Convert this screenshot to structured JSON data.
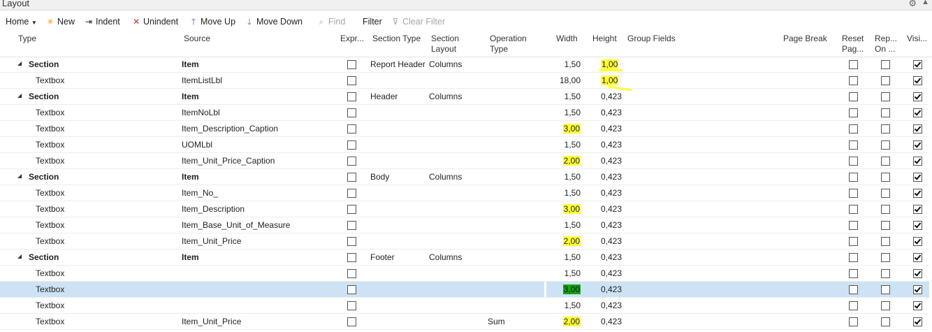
{
  "window": {
    "title": "Layout"
  },
  "toolbar": {
    "home": "Home",
    "new": "New",
    "indent": "Indent",
    "unindent": "Unindent",
    "move_up": "Move Up",
    "move_down": "Move Down",
    "find": "Find",
    "filter": "Filter",
    "clear_filter": "Clear Filter"
  },
  "columns": {
    "type": "Type",
    "source": "Source",
    "expr": "Expr...",
    "section_type": "Section Type",
    "section_layout_1": "Section",
    "section_layout_2": "Layout",
    "operation_type_1": "Operation",
    "operation_type_2": "Type",
    "width": "Width",
    "height": "Height",
    "group_fields": "Group Fields",
    "page_break": "Page Break",
    "reset_page_1": "Reset",
    "reset_page_2": "Pag...",
    "repeat_1": "Rep...",
    "repeat_2": "On ...",
    "visible": "Visi..."
  },
  "rows": [
    {
      "section": true,
      "type": "Section",
      "source": "Item",
      "expr": false,
      "section_type": "Report Header",
      "section_layout": "Columns",
      "operation_type": "",
      "width": "1,50",
      "height": "1,00",
      "width_hl": false,
      "height_hl": true,
      "reset": false,
      "repeat": false,
      "visible": true
    },
    {
      "section": false,
      "type": "Textbox",
      "source": "ItemListLbl",
      "expr": false,
      "section_type": "",
      "section_layout": "",
      "operation_type": "",
      "width": "18,00",
      "height": "1,00",
      "width_hl": false,
      "height_hl": true,
      "reset": false,
      "repeat": false,
      "visible": true
    },
    {
      "section": true,
      "type": "Section",
      "source": "Item",
      "expr": false,
      "section_type": "Header",
      "section_layout": "Columns",
      "operation_type": "",
      "width": "1,50",
      "height": "0,423",
      "width_hl": false,
      "height_hl": false,
      "reset": false,
      "repeat": false,
      "visible": true
    },
    {
      "section": false,
      "type": "Textbox",
      "source": "ItemNoLbl",
      "expr": false,
      "section_type": "",
      "section_layout": "",
      "operation_type": "",
      "width": "1,50",
      "height": "0,423",
      "width_hl": false,
      "height_hl": false,
      "reset": false,
      "repeat": false,
      "visible": true
    },
    {
      "section": false,
      "type": "Textbox",
      "source": "Item_Description_Caption",
      "expr": false,
      "section_type": "",
      "section_layout": "",
      "operation_type": "",
      "width": "3,00",
      "height": "0,423",
      "width_hl": true,
      "height_hl": false,
      "reset": false,
      "repeat": false,
      "visible": true
    },
    {
      "section": false,
      "type": "Textbox",
      "source": "UOMLbl",
      "expr": false,
      "section_type": "",
      "section_layout": "",
      "operation_type": "",
      "width": "1,50",
      "height": "0,423",
      "width_hl": false,
      "height_hl": false,
      "reset": false,
      "repeat": false,
      "visible": true
    },
    {
      "section": false,
      "type": "Textbox",
      "source": "Item_Unit_Price_Caption",
      "expr": false,
      "section_type": "",
      "section_layout": "",
      "operation_type": "",
      "width": "2,00",
      "height": "0,423",
      "width_hl": true,
      "height_hl": false,
      "reset": false,
      "repeat": false,
      "visible": true
    },
    {
      "section": true,
      "type": "Section",
      "source": "Item",
      "expr": false,
      "section_type": "Body",
      "section_layout": "Columns",
      "operation_type": "",
      "width": "1,50",
      "height": "0,423",
      "width_hl": false,
      "height_hl": false,
      "reset": false,
      "repeat": false,
      "visible": true
    },
    {
      "section": false,
      "type": "Textbox",
      "source": "Item_No_",
      "expr": false,
      "section_type": "",
      "section_layout": "",
      "operation_type": "",
      "width": "1,50",
      "height": "0,423",
      "width_hl": false,
      "height_hl": false,
      "reset": false,
      "repeat": false,
      "visible": true
    },
    {
      "section": false,
      "type": "Textbox",
      "source": "Item_Description",
      "expr": false,
      "section_type": "",
      "section_layout": "",
      "operation_type": "",
      "width": "3,00",
      "height": "0,423",
      "width_hl": true,
      "height_hl": false,
      "reset": false,
      "repeat": false,
      "visible": true
    },
    {
      "section": false,
      "type": "Textbox",
      "source": "Item_Base_Unit_of_Measure",
      "expr": false,
      "section_type": "",
      "section_layout": "",
      "operation_type": "",
      "width": "1,50",
      "height": "0,423",
      "width_hl": false,
      "height_hl": false,
      "reset": false,
      "repeat": false,
      "visible": true
    },
    {
      "section": false,
      "type": "Textbox",
      "source": "Item_Unit_Price",
      "expr": false,
      "section_type": "",
      "section_layout": "",
      "operation_type": "",
      "width": "2,00",
      "height": "0,423",
      "width_hl": true,
      "height_hl": false,
      "reset": false,
      "repeat": false,
      "visible": true
    },
    {
      "section": true,
      "type": "Section",
      "source": "Item",
      "expr": false,
      "section_type": "Footer",
      "section_layout": "Columns",
      "operation_type": "",
      "width": "1,50",
      "height": "0,423",
      "width_hl": false,
      "height_hl": false,
      "reset": false,
      "repeat": false,
      "visible": true
    },
    {
      "section": false,
      "type": "Textbox",
      "source": "",
      "expr": false,
      "section_type": "",
      "section_layout": "",
      "operation_type": "",
      "width": "1,50",
      "height": "0,423",
      "width_hl": false,
      "height_hl": false,
      "reset": false,
      "repeat": false,
      "visible": true
    },
    {
      "section": false,
      "type": "Textbox",
      "source": "",
      "expr": false,
      "section_type": "",
      "section_layout": "",
      "operation_type": "",
      "width": "3,00",
      "height": "0,423",
      "width_hl": true,
      "height_hl": false,
      "selected": true,
      "reset": false,
      "repeat": false,
      "visible": true
    },
    {
      "section": false,
      "type": "Textbox",
      "source": "",
      "expr": false,
      "section_type": "",
      "section_layout": "",
      "operation_type": "",
      "width": "1,50",
      "height": "0,423",
      "width_hl": false,
      "height_hl": false,
      "reset": false,
      "repeat": false,
      "visible": true
    },
    {
      "section": false,
      "type": "Textbox",
      "source": "Item_Unit_Price",
      "expr": false,
      "section_type": "",
      "section_layout": "",
      "operation_type": "Sum",
      "width": "2,00",
      "height": "0,423",
      "width_hl": true,
      "height_hl": false,
      "reset": false,
      "repeat": false,
      "visible": true
    }
  ]
}
